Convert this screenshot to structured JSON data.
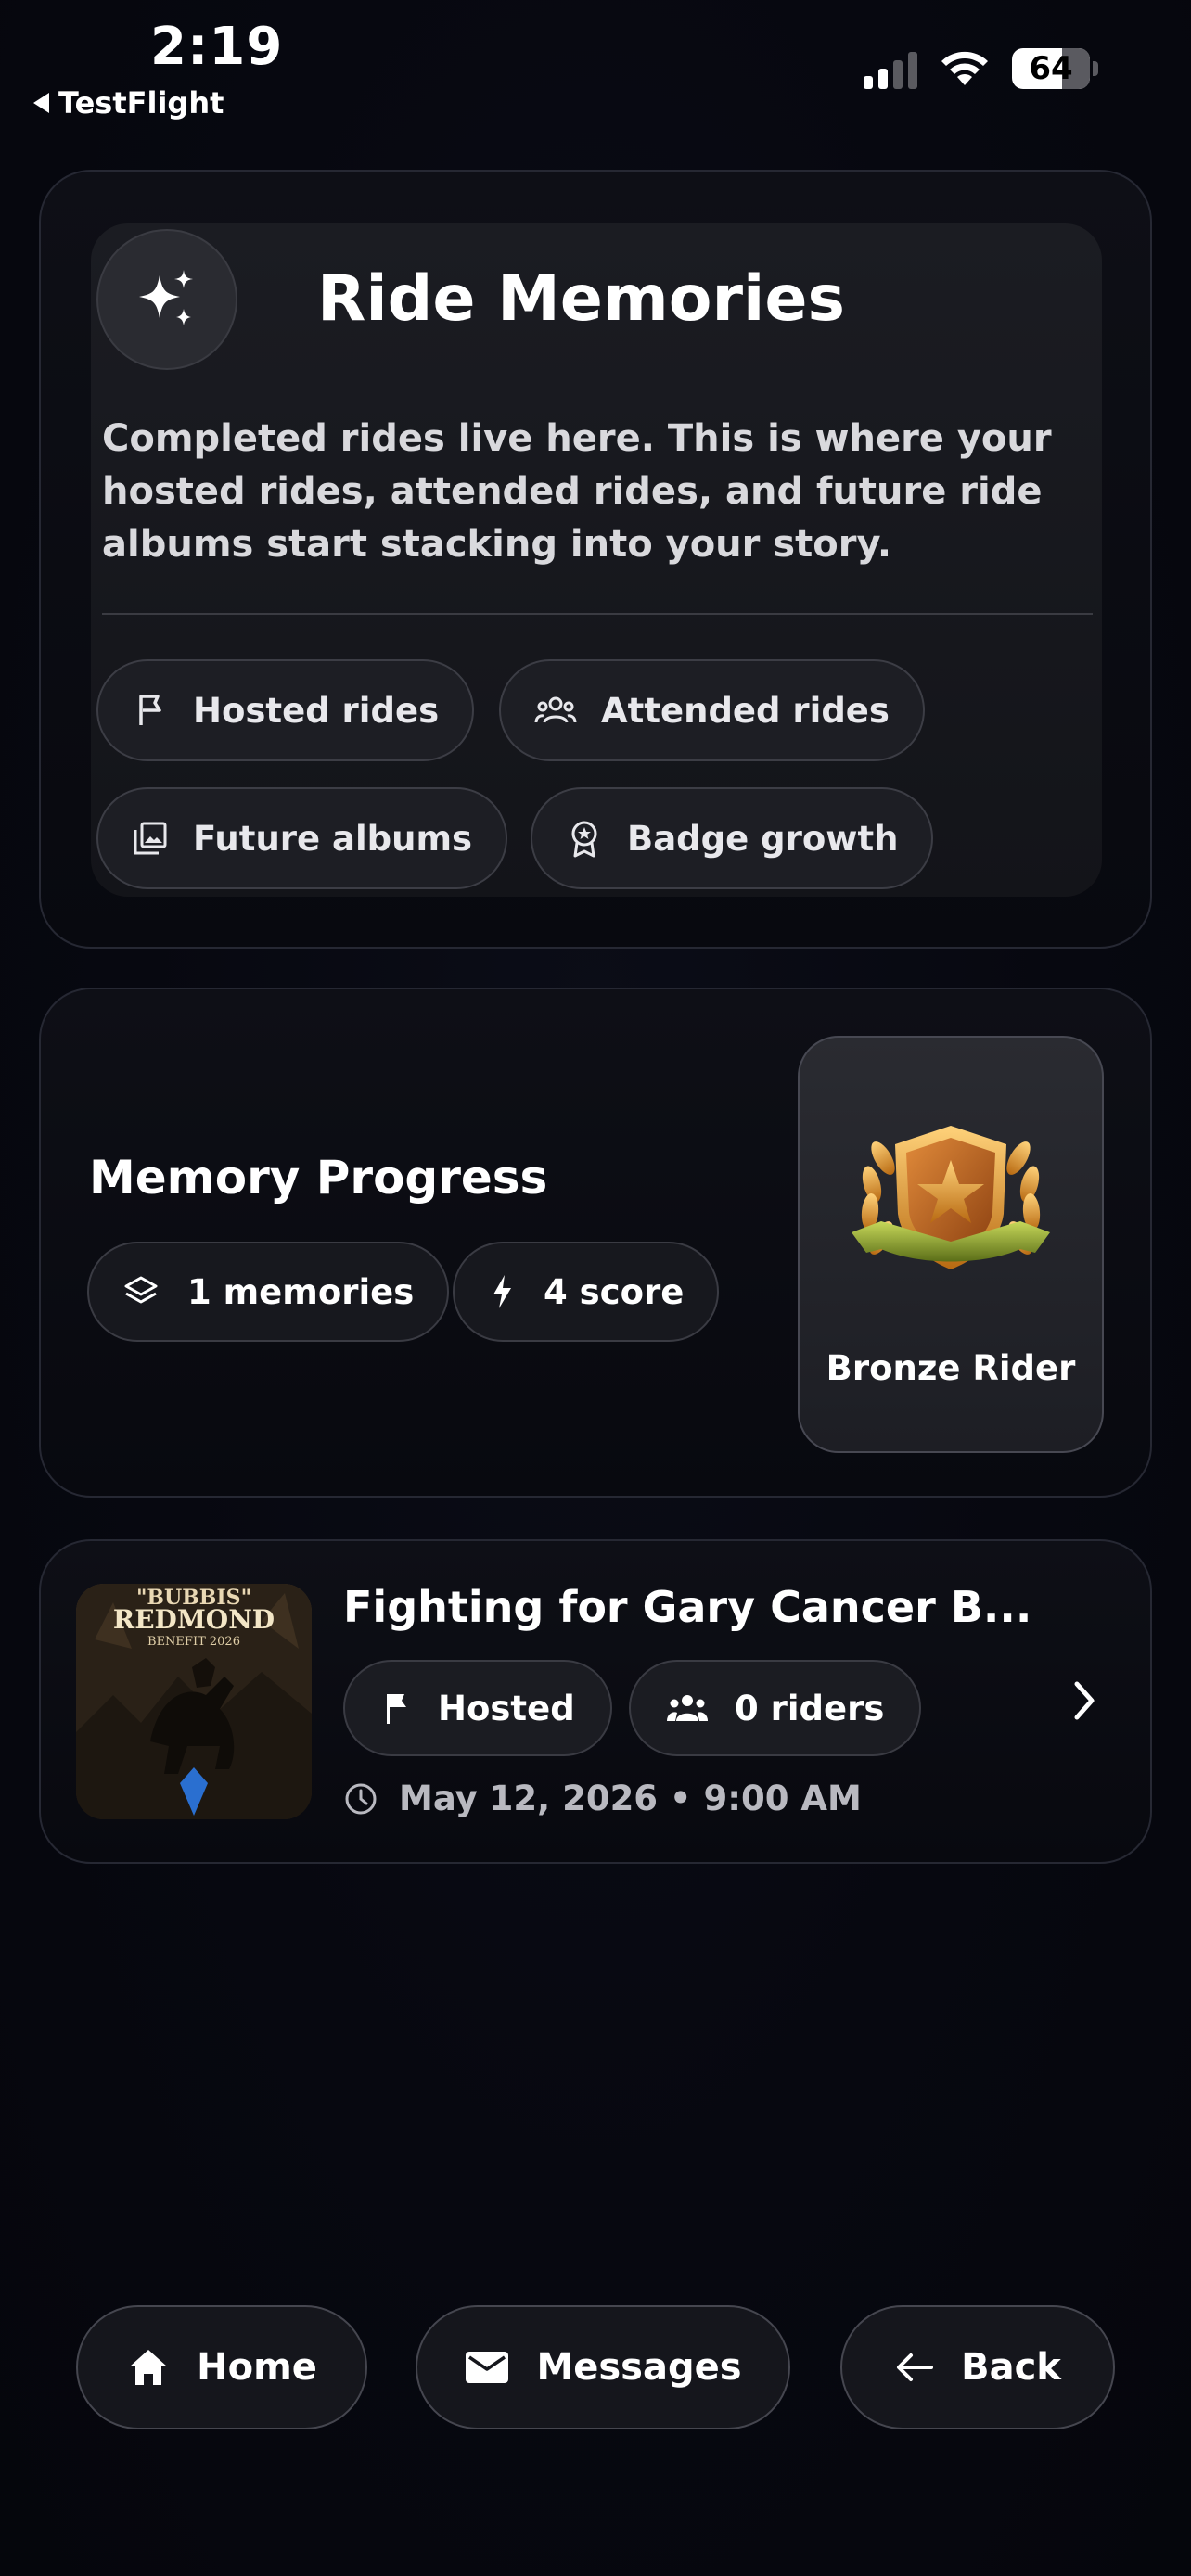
{
  "status_bar": {
    "time": "2:19",
    "back_app": "TestFlight",
    "battery": "64"
  },
  "hero": {
    "icon": "sparkles-icon",
    "title": "Ride Memories",
    "description": "Completed rides live here. This is where your hosted rides, attended rides, and future ride albums start stacking into your story.",
    "chips": [
      {
        "icon": "flag-outline-icon",
        "label": "Hosted rides"
      },
      {
        "icon": "group-icon",
        "label": "Attended rides"
      },
      {
        "icon": "photo-album-icon",
        "label": "Future albums"
      },
      {
        "icon": "award-badge-icon",
        "label": "Badge growth"
      }
    ]
  },
  "progress": {
    "title": "Memory Progress",
    "memories_label": "1 memories",
    "score_label": "4 score",
    "badge": {
      "name": "Bronze Rider",
      "icon": "bronze-shield-laurel-badge"
    }
  },
  "rides": [
    {
      "title": "Fighting for Gary Cancer B...",
      "role": "Hosted",
      "riders": "0 riders",
      "date": "May 12, 2026 • 9:00 AM",
      "thumb": {
        "line1": "\"BUBBIS\"",
        "line2": "REDMOND",
        "line3": "BENEFIT 2026"
      }
    }
  ],
  "nav": {
    "home": "Home",
    "messages": "Messages",
    "back": "Back"
  },
  "colors": {
    "background": "#070810",
    "card_border": "#262833",
    "chip_bg": "#1d1e24",
    "badge_gold": "#e0a032"
  }
}
